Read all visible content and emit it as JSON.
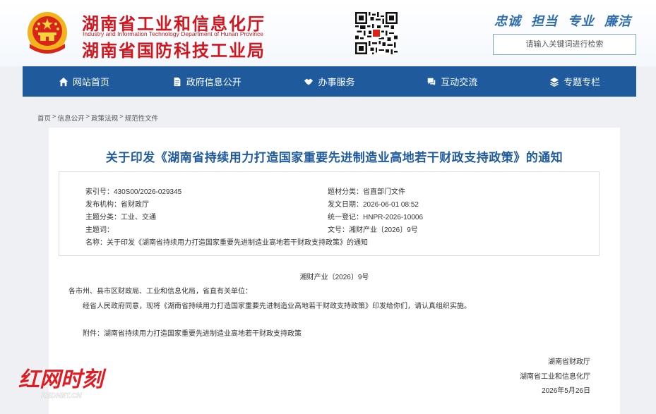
{
  "header": {
    "org_name_cn": "湖南省工业和信息化厅",
    "org_name_en": "Industry and Information Technology Department of Hunan Province",
    "org_name_cn2": "湖南省国防科技工业局",
    "slogan": [
      "忠诚",
      "担当",
      "专业",
      "廉洁"
    ],
    "search_placeholder": "请输入关键词进行检索"
  },
  "nav": {
    "items": [
      {
        "label": "网站首页",
        "icon": "home-icon"
      },
      {
        "label": "政府信息公开",
        "icon": "document-icon"
      },
      {
        "label": "办事服务",
        "icon": "handshake-icon"
      },
      {
        "label": "互动交流",
        "icon": "chat-icon"
      },
      {
        "label": "专题专栏",
        "icon": "layers-icon"
      }
    ]
  },
  "breadcrumb": {
    "items": [
      "首页",
      "信息公开",
      "政策法规",
      "规范性文件"
    ],
    "separator": ">"
  },
  "article": {
    "title": "关于印发《湖南省持续用力打造国家重要先进制造业高地若干财政支持政策》的通知",
    "meta": {
      "index_no": "索引号：430S00/2026-029345",
      "topic": "题材分类：省直部门文件",
      "publisher": "发布机构：省财政厅",
      "pub_date": "发文日期：2026-06-01 08:52",
      "subject": "主题分类：工业、交通",
      "unified_no": "统一登记：HNPR-2026-10006",
      "keywords": "主题词：",
      "doc_no": "文号：湘财产业〔2026〕9号",
      "name": "名称：关于印发《湖南省持续用力打造国家重要先进制造业高地若干财政支持政策》的通知"
    },
    "doc_number": "湘财产业〔2026〕9号",
    "recipients": "各市州、县市区财政局、工业和信息化局，省直有关单位：",
    "paragraph1": "经省人民政府同意，现将《湖南省持续用力打造国家重要先进制造业高地若干财政支持政策》印发给你们，请认真组织实施。",
    "attachment": "附件：湖南省持续用力打造国家重要先进制造业高地若干财政支持政策",
    "sign1": "湖南省财政厅",
    "sign2": "湖南省工业和信息化厅",
    "sign_date": "2026年5月26日"
  },
  "watermark": {
    "text": "红网时刻",
    "sub": "REDNET.CN"
  },
  "colors": {
    "nav_bg": "#1f5b9c",
    "title_blue": "#1f5b9c",
    "org_red": "#d2161f"
  }
}
